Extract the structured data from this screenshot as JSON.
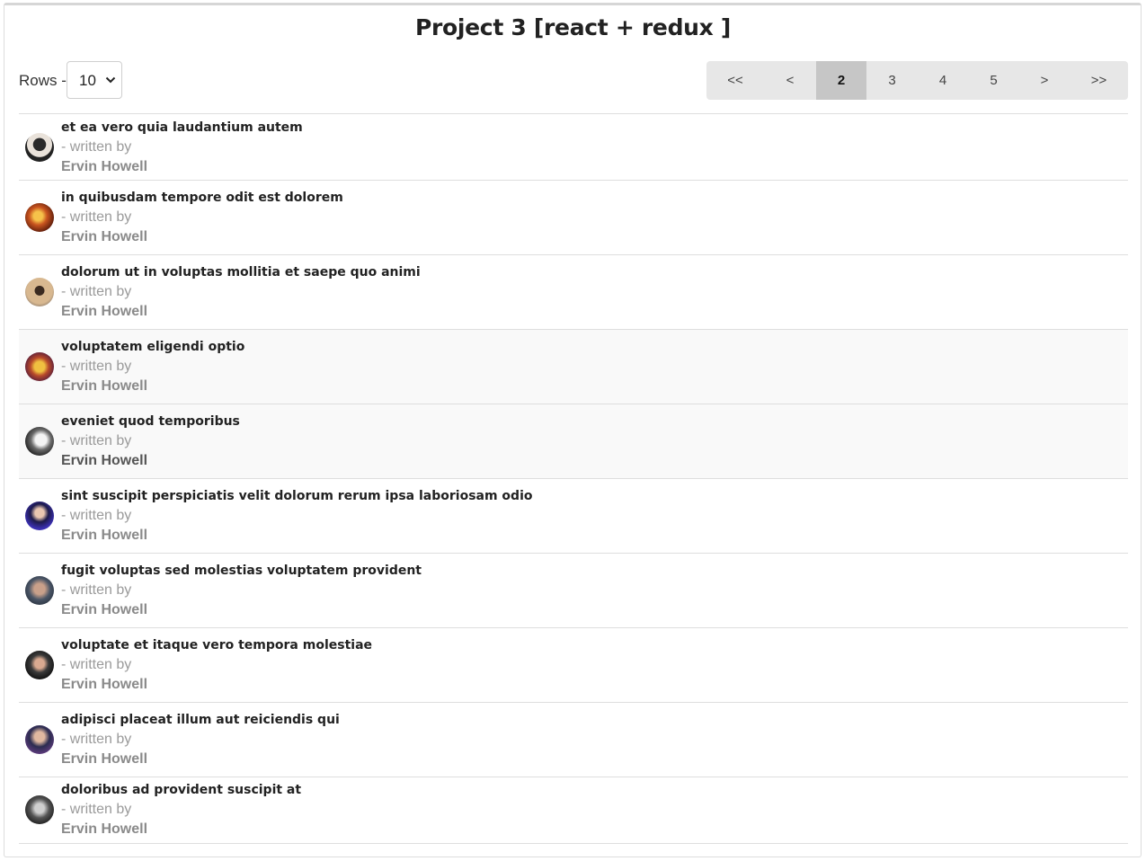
{
  "title": "Project 3 [react + redux ]",
  "rows": {
    "label": "Rows -",
    "value": "10"
  },
  "pagination": {
    "first": "<<",
    "prev": "<",
    "pages": [
      "2",
      "3",
      "4",
      "5"
    ],
    "active": "2",
    "next": ">",
    "last": ">>"
  },
  "posts": [
    {
      "title": "et ea vero quia laudantium autem",
      "written_by": "- written by",
      "author": "Ervin Howell"
    },
    {
      "title": "in quibusdam tempore odit est dolorem",
      "written_by": "- written by",
      "author": "Ervin Howell"
    },
    {
      "title": "dolorum ut in voluptas mollitia et saepe quo animi",
      "written_by": "- written by",
      "author": "Ervin Howell"
    },
    {
      "title": "voluptatem eligendi optio",
      "written_by": "- written by",
      "author": "Ervin Howell"
    },
    {
      "title": "eveniet quod temporibus",
      "written_by": "- written by",
      "author": "Ervin Howell"
    },
    {
      "title": "sint suscipit perspiciatis velit dolorum rerum ipsa laboriosam odio",
      "written_by": "- written by",
      "author": "Ervin Howell"
    },
    {
      "title": "fugit voluptas sed molestias voluptatem provident",
      "written_by": "- written by",
      "author": "Ervin Howell"
    },
    {
      "title": "voluptate et itaque vero tempora molestiae",
      "written_by": "- written by",
      "author": "Ervin Howell"
    },
    {
      "title": "adipisci placeat illum aut reiciendis qui",
      "written_by": "- written by",
      "author": "Ervin Howell"
    },
    {
      "title": "doloribus ad provident suscipit at",
      "written_by": "- written by",
      "author": "Ervin Howell"
    }
  ]
}
